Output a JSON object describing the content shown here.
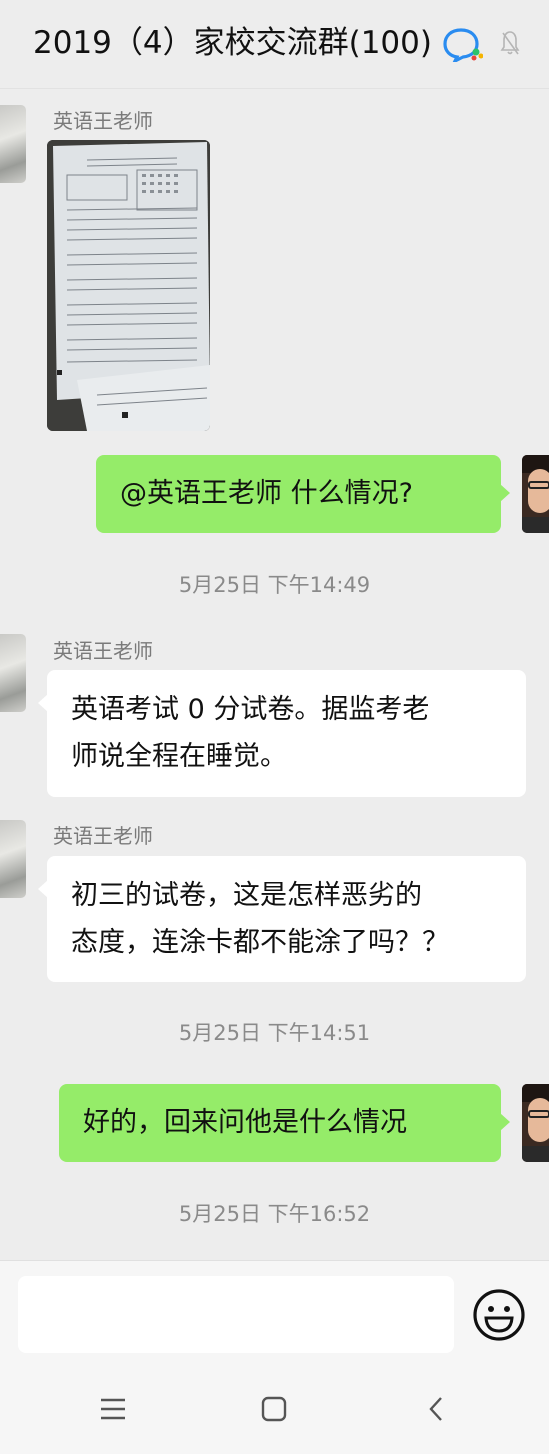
{
  "header": {
    "title": "2019（4）家校交流群(100)",
    "icons": [
      "qq-group-icon",
      "mute-bell-icon"
    ]
  },
  "messages": [
    {
      "type": "image",
      "sender": "英语王老师",
      "side": "left",
      "image_desc_icon": "exam-paper-photo"
    },
    {
      "type": "text",
      "side": "right",
      "text": "@英语王老师  什么情况?"
    },
    {
      "type": "time",
      "text": "5月25日 下午14:49"
    },
    {
      "type": "text",
      "sender": "英语王老师",
      "side": "left",
      "lines": [
        "英语考试 0 分试卷。据监考老",
        "师说全程在睡觉。"
      ]
    },
    {
      "type": "text",
      "sender": "英语王老师",
      "side": "left",
      "lines": [
        "初三的试卷，这是怎样恶劣的",
        "态度，连涂卡都不能涂了吗？？"
      ]
    },
    {
      "type": "time",
      "text": "5月25日 下午14:51"
    },
    {
      "type": "text",
      "side": "right",
      "text": "好的，回来问他是什么情况"
    },
    {
      "type": "time",
      "text": "5月25日 下午16:52"
    }
  ],
  "input": {
    "value": "",
    "placeholder": ""
  },
  "icons": {
    "emoji": "emoji-face-icon",
    "nav_menu": "menu-lines-icon",
    "nav_home": "home-square-icon",
    "nav_back": "back-chevron-icon"
  },
  "colors": {
    "background": "#ededed",
    "bubble_self": "#95ec69",
    "bubble_other": "#ffffff",
    "timestamp": "#8a8a8a"
  }
}
